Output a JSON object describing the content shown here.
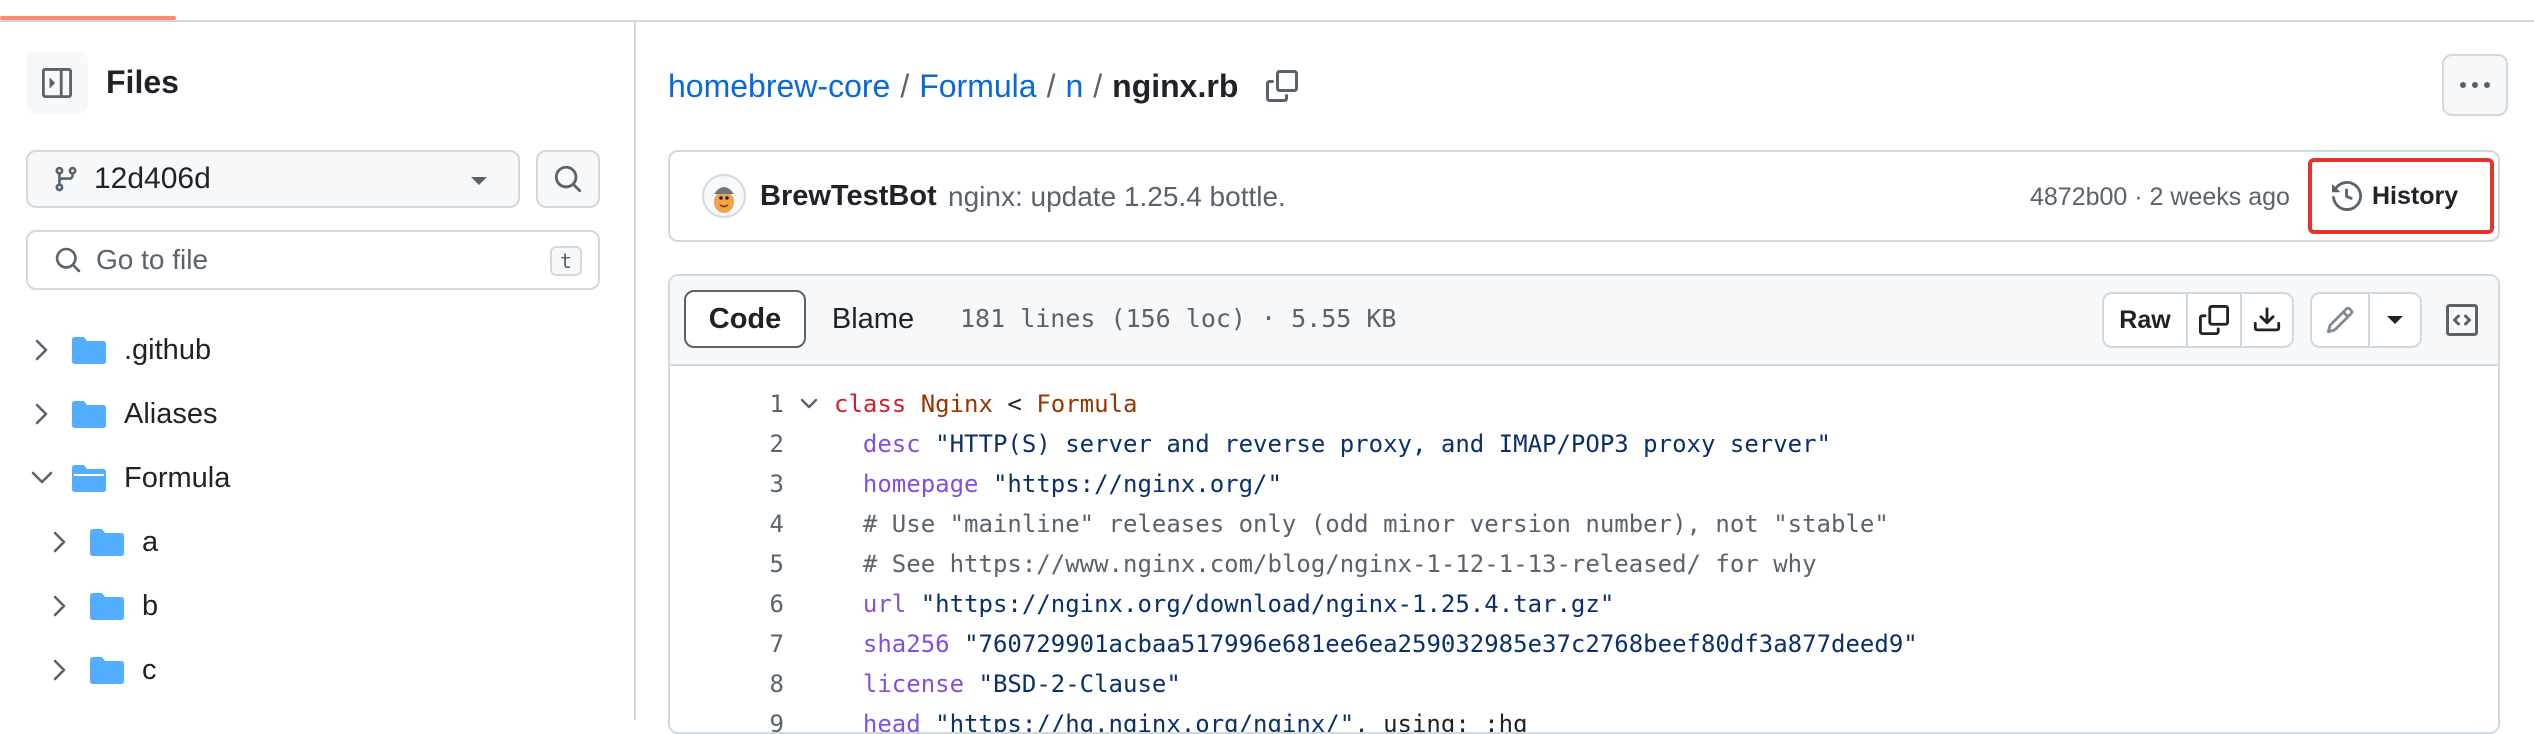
{
  "sidebar": {
    "title": "Files",
    "branch": "12d406d",
    "goto_placeholder": "Go to file",
    "goto_shortcut": "t",
    "tree": [
      {
        "name": ".github",
        "expanded": false,
        "depth": 0
      },
      {
        "name": "Aliases",
        "expanded": false,
        "depth": 0
      },
      {
        "name": "Formula",
        "expanded": true,
        "depth": 0
      },
      {
        "name": "a",
        "expanded": false,
        "depth": 1
      },
      {
        "name": "b",
        "expanded": false,
        "depth": 1
      },
      {
        "name": "c",
        "expanded": false,
        "depth": 1
      }
    ]
  },
  "breadcrumb": {
    "repo": "homebrew-core",
    "sep": "/",
    "dir1": "Formula",
    "dir2": "n",
    "file": "nginx.rb"
  },
  "commit": {
    "author": "BrewTestBot",
    "message": "nginx: update 1.25.4 bottle.",
    "meta": "4872b00 · 2 weeks ago",
    "history_label": "History"
  },
  "code_header": {
    "tab_code": "Code",
    "tab_blame": "Blame",
    "file_info": "181 lines (156 loc) · 5.55 KB",
    "raw_label": "Raw"
  },
  "code": {
    "line_numbers": [
      "1",
      "2",
      "3",
      "4",
      "5",
      "6",
      "7",
      "8",
      "9"
    ],
    "l1": {
      "kw": "class",
      "name": "Nginx",
      "op": " < ",
      "parent": "Formula"
    },
    "l2": {
      "m": "desc",
      "s": "\"HTTP(S) server and reverse proxy, and IMAP/POP3 proxy server\""
    },
    "l3": {
      "m": "homepage",
      "s": "\"https://nginx.org/\""
    },
    "l4": {
      "c": "# Use \"mainline\" releases only (odd minor version number), not \"stable\""
    },
    "l5": {
      "c": "# See https://www.nginx.com/blog/nginx-1-12-1-13-released/ for why"
    },
    "l6": {
      "m": "url",
      "s": "\"https://nginx.org/download/nginx-1.25.4.tar.gz\""
    },
    "l7": {
      "m": "sha256",
      "s": "\"760729901acbaa517996e681ee6ea259032985e37c2768beef80df3a877deed9\""
    },
    "l8": {
      "m": "license",
      "s": "\"BSD-2-Clause\""
    },
    "l9": {
      "m": "head",
      "s": "\"https://hg.nginx.org/nginx/\"",
      "rest": ", using: :hg"
    }
  },
  "colors": {
    "link": "#0969da",
    "highlight_border": "#e5332a",
    "folder": "#54aeff",
    "tab_accent": "#fd8c73"
  }
}
